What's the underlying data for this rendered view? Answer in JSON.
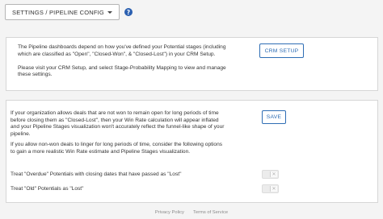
{
  "header": {
    "dropdown_label": "SETTINGS / PIPELINE CONFIG",
    "help_icon_glyph": "?"
  },
  "crm_panel": {
    "line1": "The Pipeline dashboards depend on how you've defined your Potential stages (including",
    "line2": "which are classified as \"Open\", \"Closed-Won\", & \"Closed-Lost\") in your CRM Setup.",
    "line3": "Please visit your CRM Setup, and select Stage-Probability Mapping to view and manage",
    "line4": "these settings.",
    "button_label": "CRM SETUP"
  },
  "settings_panel": {
    "para1_line1": "If your organization allows deals that are not won to remain open for long periods of time",
    "para1_line2": "before closing them as \"Closed-Lost\", then your Win Rate calculation will appear inflated",
    "para1_line3": "and your Pipeline Stages visualization won't accurately reflect the funnel-like shape of your",
    "para1_line4": "pipeline.",
    "para2_line1": "If you allow non-won deals to linger for long periods of time, consider the following options",
    "para2_line2": "to gain a more realistic Win Rate estimate and Pipeline Stages visualization.",
    "option1_label": "Treat \"Overdue\" Potentials with closing dates that have passed as \"Lost\"",
    "option2_label": "Treat \"Old\" Potentials as \"Lost\"",
    "option1_on": false,
    "option2_on": false,
    "toggle_off_glyph": "✕",
    "save_label": "SAVE"
  },
  "footer": {
    "privacy_label": "Privacy Policy",
    "terms_label": "Terms of Service"
  },
  "colors": {
    "accent": "#2e6db4",
    "help_icon": "#2a5fb0",
    "background": "#f4f4f4"
  }
}
